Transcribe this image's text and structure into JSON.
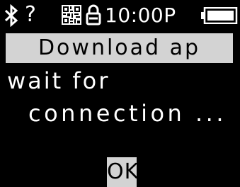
{
  "status_bar": {
    "bluetooth_icon": "bluetooth-icon",
    "unknown_mark": "?",
    "qr_icon": "qr-code-icon",
    "lock_icon": "lock-icon",
    "time": "10:00P",
    "battery_icon": "battery-full-icon"
  },
  "title": "Download ap",
  "message": {
    "line1": "wait for",
    "line2": "connection ..."
  },
  "ok_button": {
    "label": "OK"
  },
  "colors": {
    "background": "#000000",
    "foreground": "#ffffff",
    "highlight": "#d3d3d3",
    "highlight_text": "#000000"
  }
}
